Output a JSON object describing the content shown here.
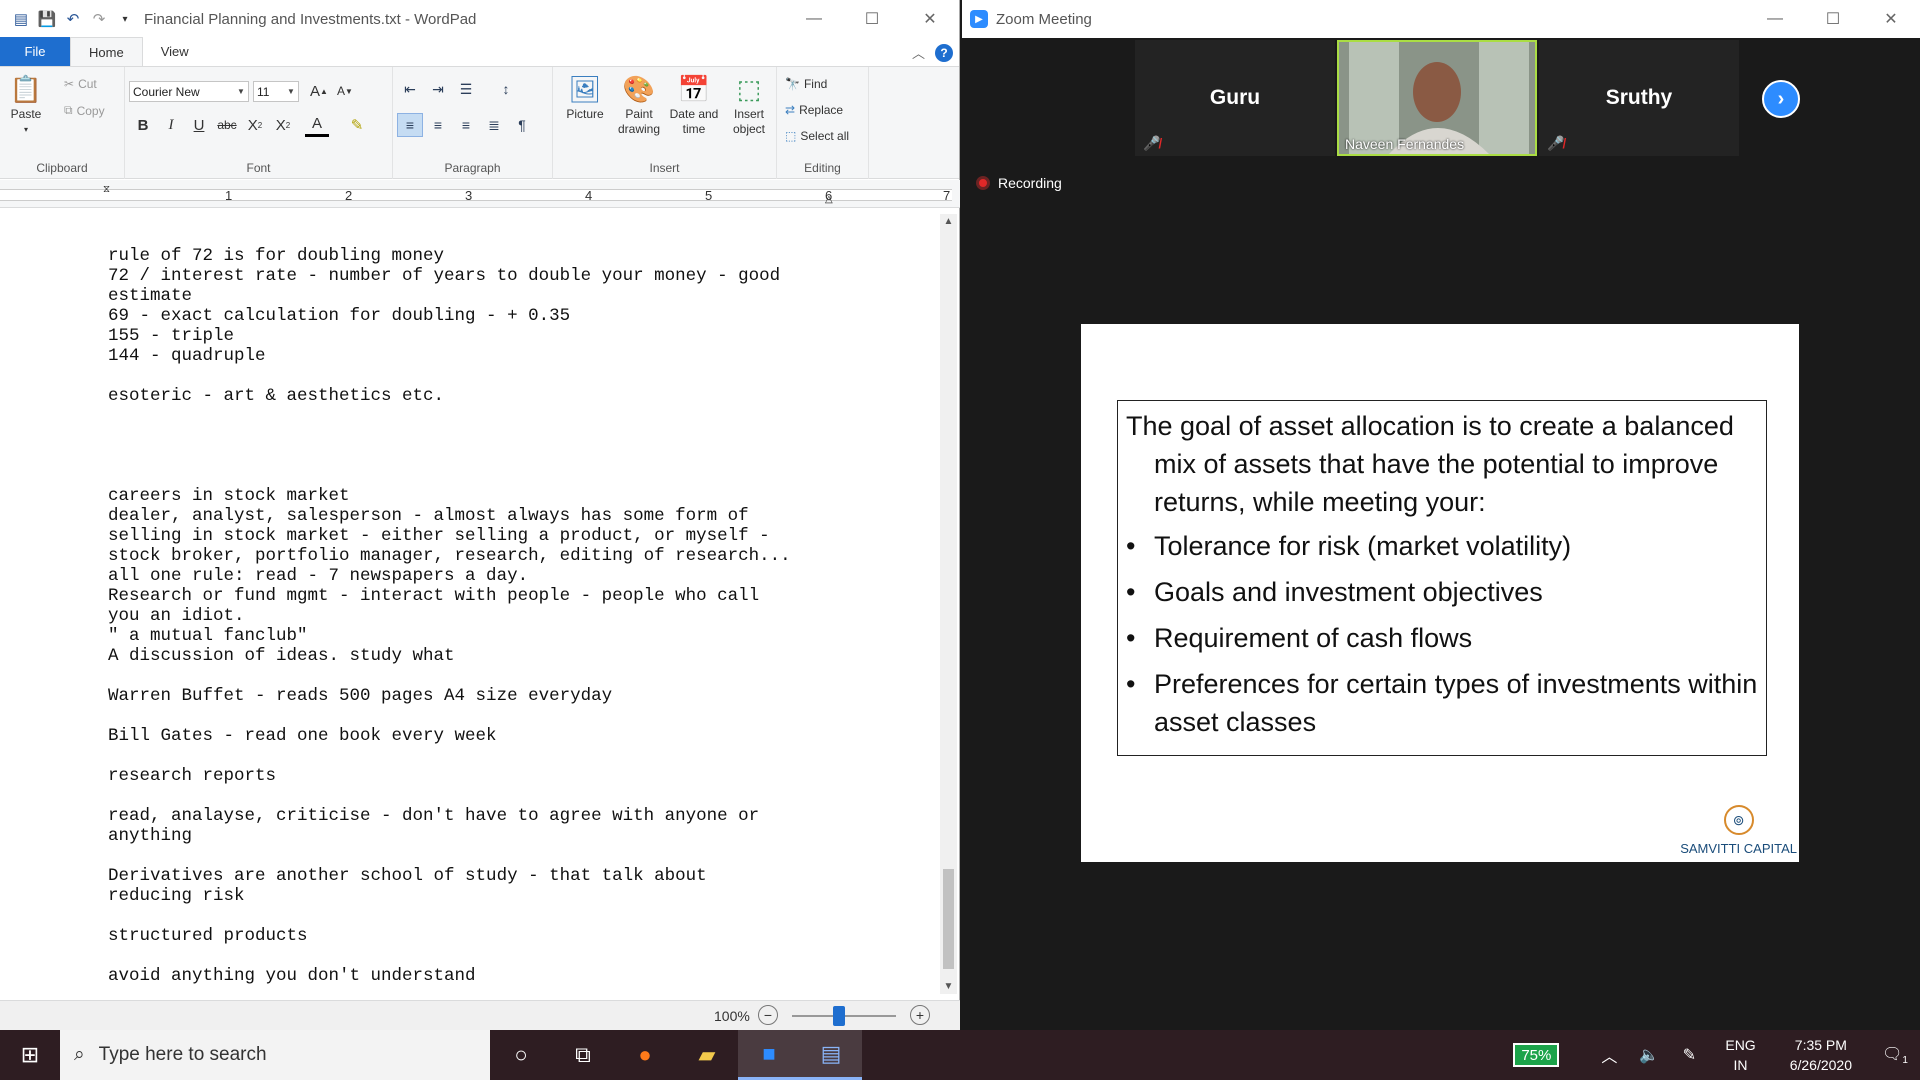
{
  "wordpad": {
    "title": "Financial Planning and Investments.txt - WordPad",
    "tabs": [
      "File",
      "Home",
      "View"
    ],
    "clipboard": {
      "group": "Clipboard",
      "paste": "Paste",
      "cut": "Cut",
      "copy": "Copy"
    },
    "font": {
      "group": "Font",
      "family": "Courier New",
      "size": "11"
    },
    "paragraph": {
      "group": "Paragraph"
    },
    "insert": {
      "group": "Insert",
      "picture": "Picture",
      "paint": "Paint drawing",
      "datetime": "Date and time",
      "object": "Insert object"
    },
    "editing": {
      "group": "Editing",
      "find": "Find",
      "replace": "Replace",
      "select_all": "Select all"
    },
    "ruler_numbers": [
      "1",
      "2",
      "3",
      "4",
      "5",
      "6",
      "7"
    ],
    "document_text": "rule of 72 is for doubling money\n72 / interest rate - number of years to double your money - good\nestimate\n69 - exact calculation for doubling - + 0.35\n155 - triple\n144 - quadruple\n\nesoteric - art & aesthetics etc.\n\n\n\n\ncareers in stock market\ndealer, analyst, salesperson - almost always has some form of\nselling in stock market - either selling a product, or myself -\nstock broker, portfolio manager, research, editing of research...\nall one rule: read - 7 newspapers a day.\nResearch or fund mgmt - interact with people - people who call\nyou an idiot.\n\" a mutual fanclub\"\nA discussion of ideas. study what\n\nWarren Buffet - reads 500 pages A4 size everyday\n\nBill Gates - read one book every week\n\nresearch reports\n\nread, analayse, criticise - don't have to agree with anyone or\nanything\n\nDerivatives are another school of study - that talk about\nreducing risk\n\nstructured products\n\navoid anything you don't understand",
    "zoom_level": "100%",
    "zoom_fraction": 0.45
  },
  "zoom": {
    "title": "Zoom Meeting",
    "participants": [
      {
        "name": "Guru",
        "muted": true,
        "video": false
      },
      {
        "name": "Naveen Fernandes",
        "muted": false,
        "video": true
      },
      {
        "name": "Sruthy",
        "muted": true,
        "video": false
      }
    ],
    "recording_label": "Recording",
    "slide": {
      "intro": "The goal of asset allocation is to create a balanced mix of assets that have the potential to improve returns, while meeting your:",
      "bullets": [
        "Tolerance for risk (market volatility)",
        "Goals and investment objectives",
        "Requirement of cash flows",
        "Preferences for certain types of investments within asset classes"
      ],
      "brand": "SAMVITTI CAPITAL"
    }
  },
  "taskbar": {
    "search_placeholder": "Type here to search",
    "battery": "75%",
    "lang_top": "ENG",
    "lang_bottom": "IN",
    "time": "7:35 PM",
    "date": "6/26/2020",
    "notifications": "1"
  },
  "colors": {
    "accent": "#1e6ecf",
    "zoom_blue": "#2d8cff",
    "taskbar": "#2e1d22",
    "recording": "#e02828"
  }
}
